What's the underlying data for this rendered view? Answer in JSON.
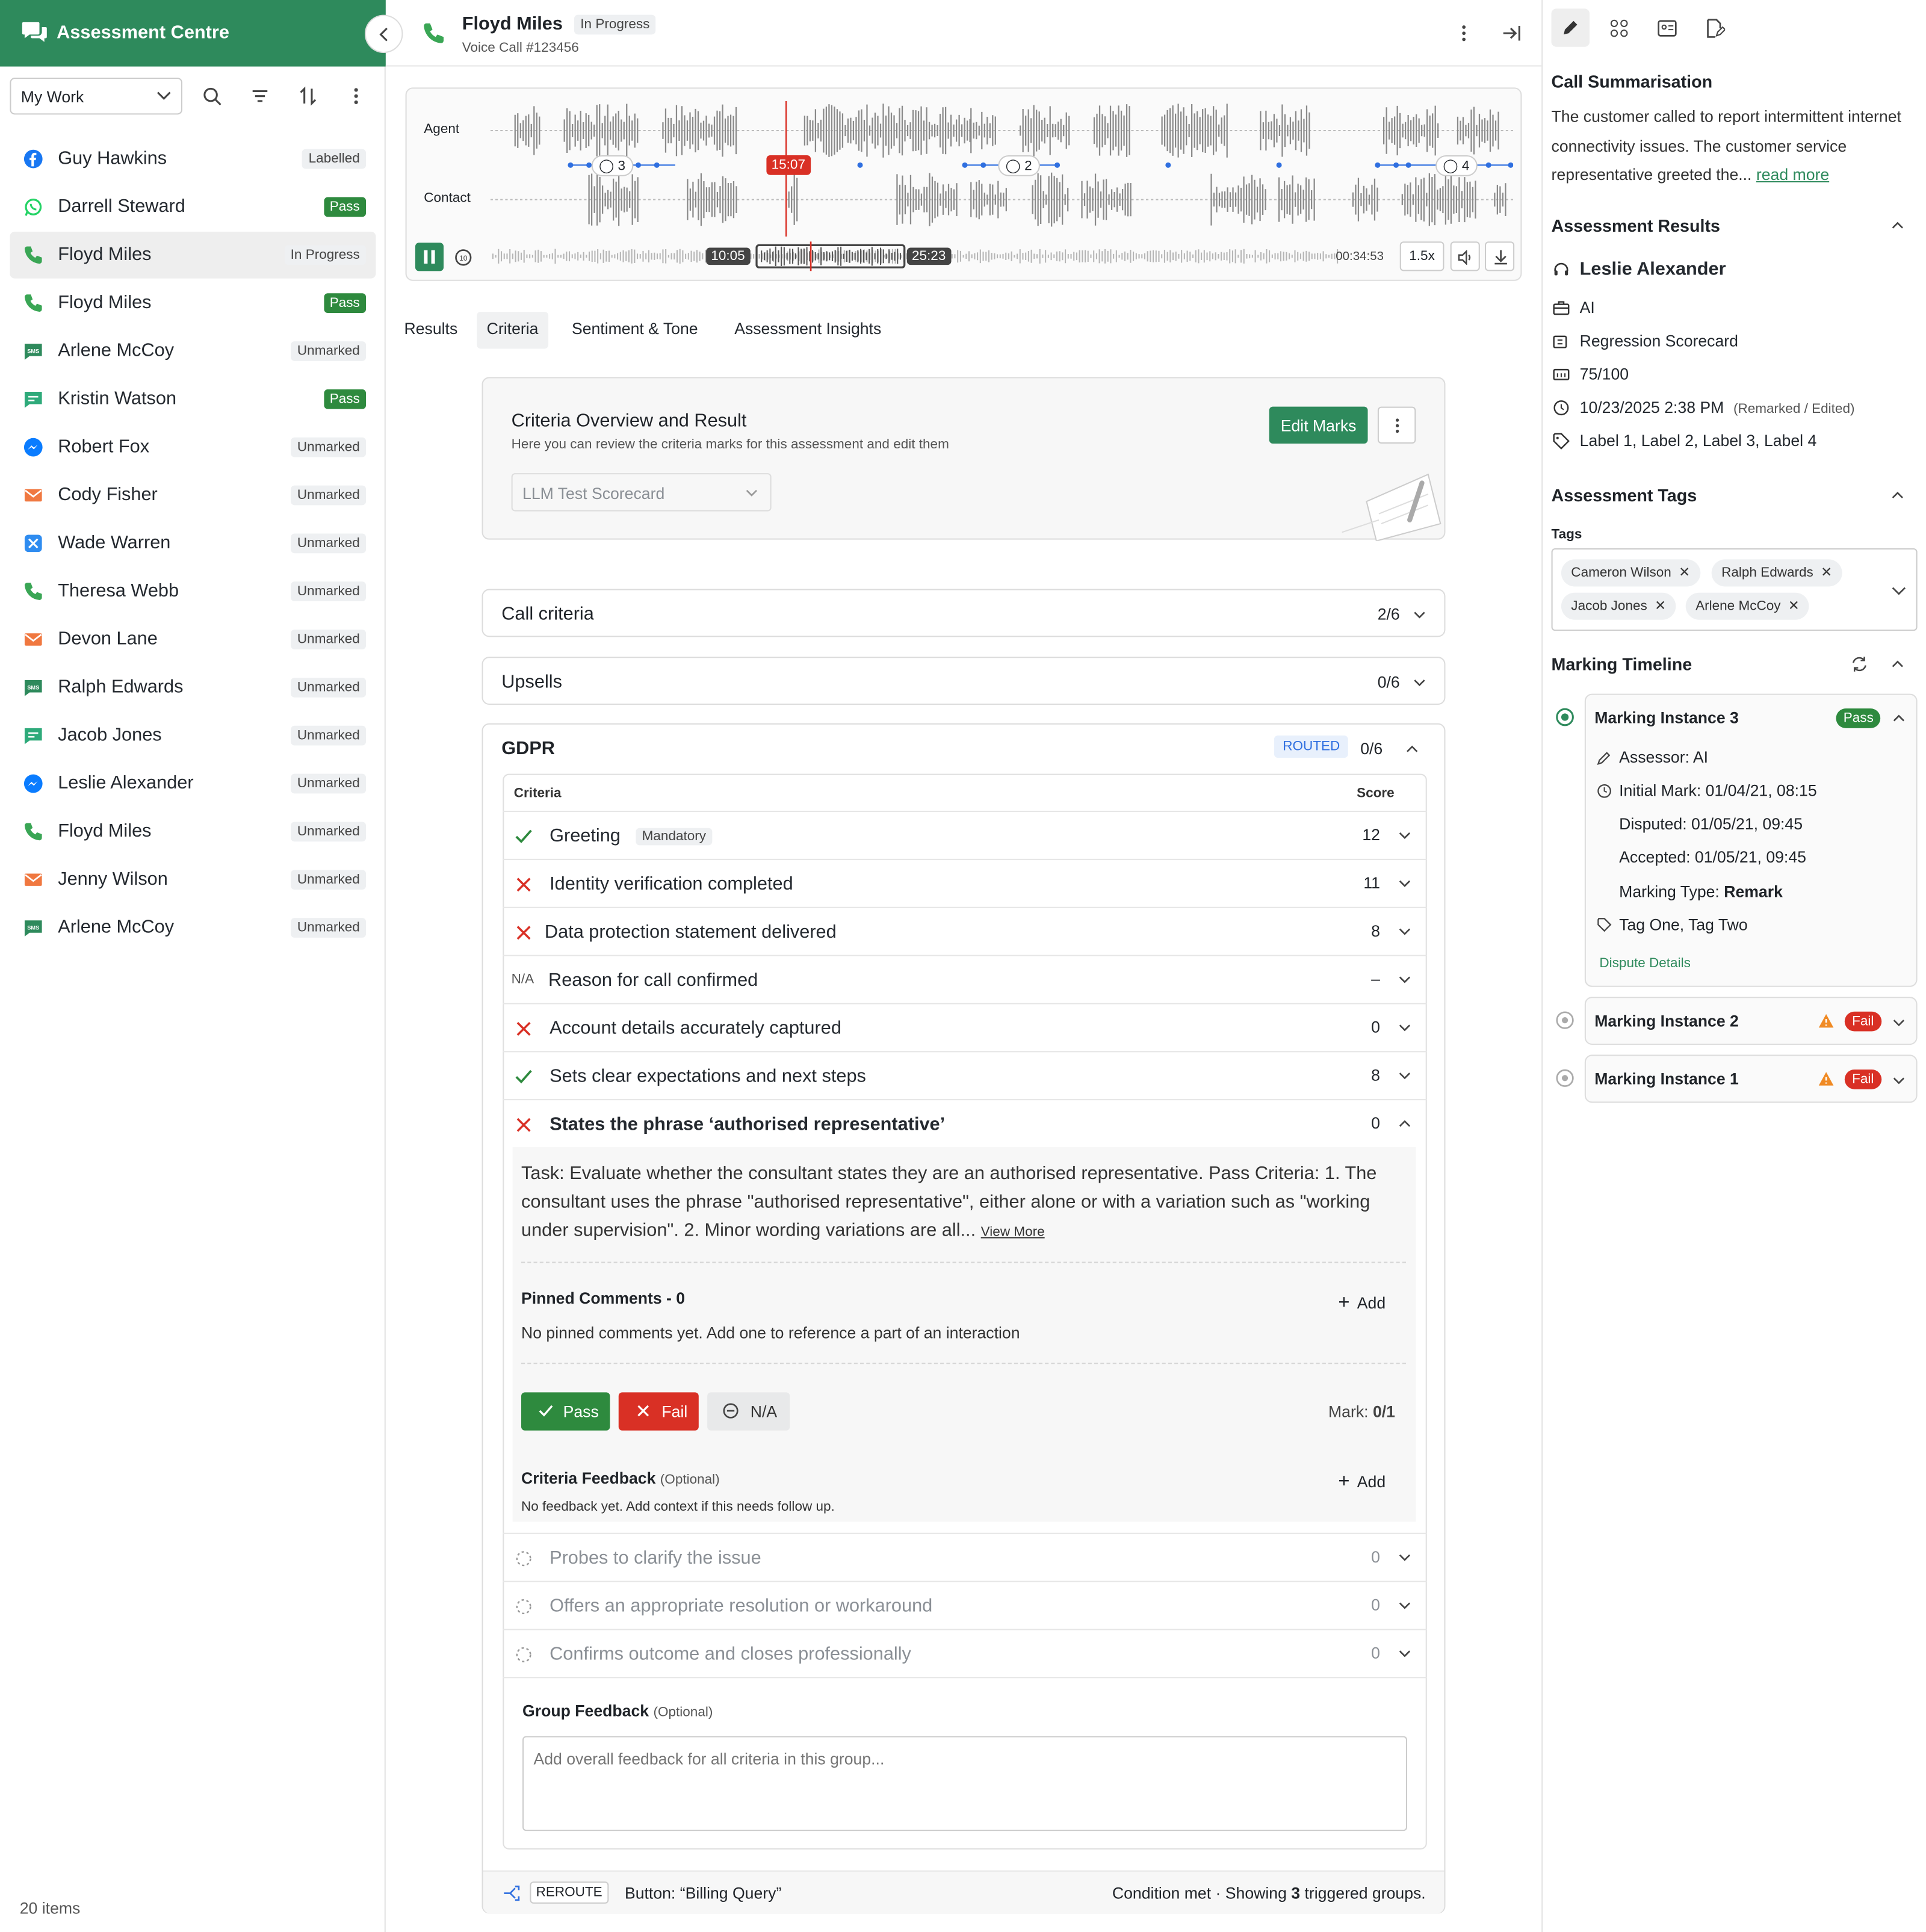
{
  "sidebar": {
    "title": "Assessment Centre",
    "filter": "My Work",
    "count": "20 items",
    "items": [
      {
        "name": "Guy Hawkins",
        "status": "Labelled",
        "channel": "facebook"
      },
      {
        "name": "Darrell Steward",
        "status": "Pass",
        "channel": "whatsapp"
      },
      {
        "name": "Floyd Miles",
        "status": "In Progress",
        "channel": "phone"
      },
      {
        "name": "Floyd Miles",
        "status": "Pass",
        "channel": "phone"
      },
      {
        "name": "Arlene McCoy",
        "status": "Unmarked",
        "channel": "sms"
      },
      {
        "name": "Kristin Watson",
        "status": "Pass",
        "channel": "chat"
      },
      {
        "name": "Robert Fox",
        "status": "Unmarked",
        "channel": "messenger"
      },
      {
        "name": "Cody Fisher",
        "status": "Unmarked",
        "channel": "email"
      },
      {
        "name": "Wade Warren",
        "status": "Unmarked",
        "channel": "x"
      },
      {
        "name": "Theresa Webb",
        "status": "Unmarked",
        "channel": "phone"
      },
      {
        "name": "Devon Lane",
        "status": "Unmarked",
        "channel": "email"
      },
      {
        "name": "Ralph Edwards",
        "status": "Unmarked",
        "channel": "sms"
      },
      {
        "name": "Jacob Jones",
        "status": "Unmarked",
        "channel": "chat"
      },
      {
        "name": "Leslie Alexander",
        "status": "Unmarked",
        "channel": "messenger"
      },
      {
        "name": "Floyd Miles",
        "status": "Unmarked",
        "channel": "phone"
      },
      {
        "name": "Jenny Wilson",
        "status": "Unmarked",
        "channel": "email"
      },
      {
        "name": "Arlene McCoy",
        "status": "Unmarked",
        "channel": "sms"
      }
    ]
  },
  "header": {
    "title": "Floyd Miles",
    "status": "In Progress",
    "subtitle": "Voice Call #123456"
  },
  "player": {
    "agent_label": "Agent",
    "contact_label": "Contact",
    "playhead": "15:07",
    "comments": [
      "3",
      "2",
      "4"
    ],
    "range_start": "10:05",
    "range_end": "25:23",
    "duration": "00:34:53",
    "speed": "1.5x"
  },
  "tabs": [
    "Results",
    "Criteria",
    "Sentiment & Tone",
    "Assessment Insights"
  ],
  "overview": {
    "title": "Criteria Overview and Result",
    "subtitle": "Here you can review the criteria marks for this assessment and edit them",
    "edit_button": "Edit Marks",
    "scorecard": "LLM Test Scorecard"
  },
  "groups": {
    "call": {
      "name": "Call criteria",
      "score": "2/6"
    },
    "upsells": {
      "name": "Upsells",
      "score": "0/6"
    },
    "gdpr": {
      "name": "GDPR",
      "badge": "ROUTED",
      "score": "0/6"
    }
  },
  "table": {
    "col_criteria": "Criteria",
    "col_score": "Score",
    "mandatory": "Mandatory",
    "na": "N/A",
    "rows": [
      {
        "label": "Greeting",
        "score": "12",
        "state": "pass"
      },
      {
        "label": "Identity verification completed",
        "score": "11",
        "state": "fail"
      },
      {
        "label": "Data protection statement delivered",
        "score": "8",
        "state": "fail"
      },
      {
        "label": "Reason for call confirmed",
        "score": "–",
        "state": "na"
      },
      {
        "label": "Account details accurately captured",
        "score": "0",
        "state": "fail"
      },
      {
        "label": "Sets clear expectations and next steps",
        "score": "8",
        "state": "pass"
      },
      {
        "label": "States the phrase ‘authorised representative’",
        "score": "0",
        "state": "fail"
      }
    ],
    "pending": [
      {
        "label": "Probes to clarify the issue",
        "score": "0"
      },
      {
        "label": "Offers an appropriate resolution or workaround",
        "score": "0"
      },
      {
        "label": "Confirms outcome and closes professionally",
        "score": "0"
      }
    ]
  },
  "detail": {
    "task": "Task: Evaluate whether the consultant states they are an authorised representative. Pass Criteria: 1. The consultant uses the phrase \"authorised representative\", either alone or with a variation such as \"working under supervision\". 2. Minor wording variations are all...",
    "view_more": "View More",
    "pinned_title": "Pinned Comments - 0",
    "add": "Add",
    "pinned_empty": "No pinned comments yet. Add one to reference a part of an interaction",
    "pass": "Pass",
    "fail": "Fail",
    "na": "N/A",
    "mark_label": "Mark:",
    "mark_value": "0/1",
    "feedback_title": "Criteria Feedback",
    "optional": "(Optional)",
    "feedback_empty": "No feedback yet. Add context if this needs follow up."
  },
  "group_feedback": {
    "title": "Group Feedback",
    "optional": "(Optional)",
    "placeholder": "Add overall feedback for all criteria in this group..."
  },
  "footer": {
    "reroute": "REROUTE",
    "button": "Button: “Billing Query”",
    "condition": "Condition met · Showing ",
    "count": "3",
    "suffix": " triggered groups."
  },
  "right": {
    "summary_title": "Call Summarisation",
    "summary": "The customer called to report intermittent internet connectivity issues. The customer service representative greeted the...",
    "read_more": "read more",
    "results_title": "Assessment Results",
    "assessee": "Leslie Alexander",
    "assessor": "AI",
    "scorecard": "Regression Scorecard",
    "score": "75/100",
    "date": "10/23/2025 2:38 PM",
    "date_note": "(Remarked / Edited)",
    "labels": "Label 1, Label 2, Label 3, Label 4",
    "tags_title": "Assessment Tags",
    "tags_label": "Tags",
    "tags": [
      "Cameron Wilson",
      "Ralph Edwards",
      "Jacob Jones",
      "Arlene McCoy"
    ],
    "timeline_title": "Marking Timeline",
    "inst3": {
      "title": "Marking Instance 3",
      "status": "Pass",
      "assessor_label": "Assessor: ",
      "assessor": "AI",
      "initial_label": "Initial Mark: ",
      "initial": "01/04/21, 08:15",
      "disputed_label": "Disputed: ",
      "disputed": "01/05/21, 09:45",
      "accepted_label": "Accepted: ",
      "accepted": "01/05/21, 09:45",
      "type_label": "Marking Type: ",
      "type": "Remark",
      "tags": "Tag One, Tag Two",
      "dispute": "Dispute Details"
    },
    "inst2": {
      "title": "Marking Instance 2",
      "status": "Fail"
    },
    "inst1": {
      "title": "Marking Instance 1",
      "status": "Fail"
    }
  },
  "colors": {
    "brand": "#2e8a5c",
    "pass": "#2e8a3e",
    "fail": "#d93025",
    "playhead": "#d93025",
    "accent_blue": "#2f6fe0"
  }
}
